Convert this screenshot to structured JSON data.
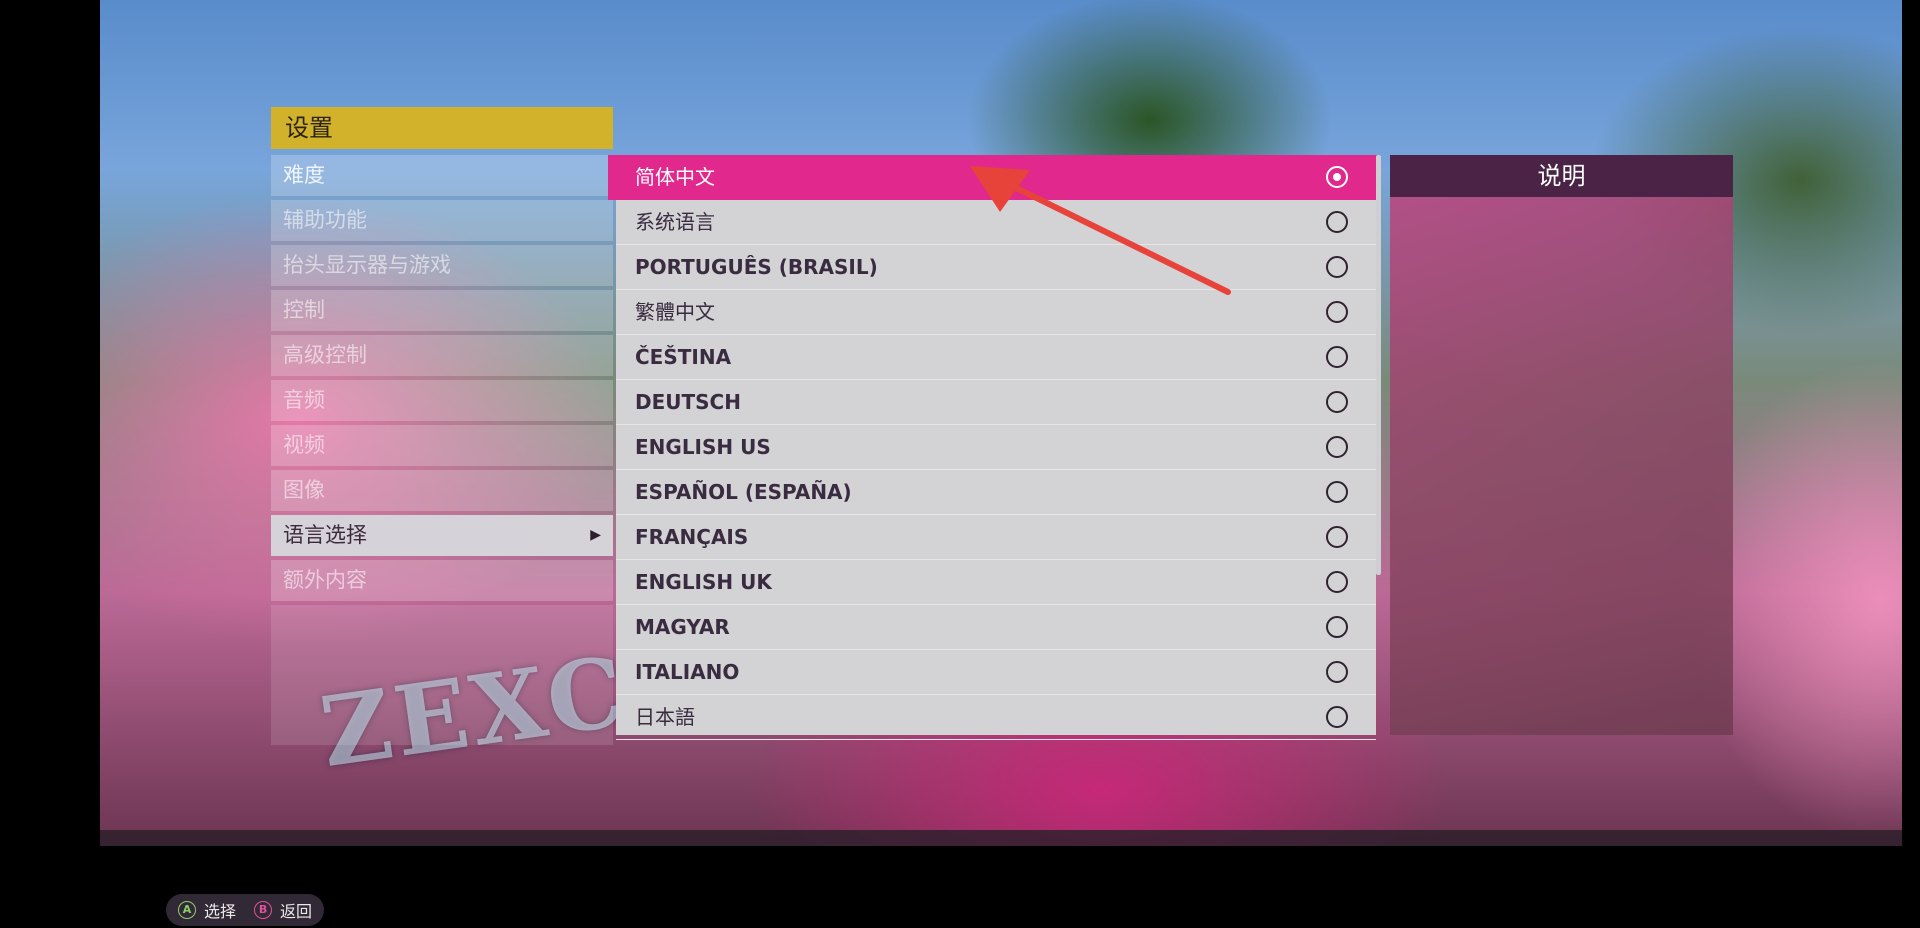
{
  "settings": {
    "title": "设置",
    "menu": [
      {
        "label": "难度"
      },
      {
        "label": "辅助功能"
      },
      {
        "label": "抬头显示器与游戏"
      },
      {
        "label": "控制"
      },
      {
        "label": "高级控制"
      },
      {
        "label": "音频"
      },
      {
        "label": "视频"
      },
      {
        "label": "图像"
      },
      {
        "label": "语言选择",
        "active": true
      },
      {
        "label": "额外内容"
      }
    ]
  },
  "languages": [
    {
      "label": "简体中文",
      "selected": true
    },
    {
      "label": "系统语言"
    },
    {
      "label": "PORTUGUÊS (BRASIL)"
    },
    {
      "label": "繁體中文"
    },
    {
      "label": "ČEŠTINA"
    },
    {
      "label": "DEUTSCH"
    },
    {
      "label": "ENGLISH US"
    },
    {
      "label": "ESPAÑOL (ESPAÑA)"
    },
    {
      "label": "FRANÇAIS"
    },
    {
      "label": "ENGLISH UK"
    },
    {
      "label": "MAGYAR"
    },
    {
      "label": "ITALIANO"
    },
    {
      "label": "日本語"
    }
  ],
  "description": {
    "title": "说明"
  },
  "background": {
    "graffiti_text": "ZEXCS"
  },
  "hints": {
    "select_key": "A",
    "select_label": "选择",
    "back_key": "B",
    "back_label": "返回"
  },
  "colors": {
    "accent_pink": "#e1288c",
    "title_gold": "#d2b22a",
    "annotation_red": "#e8433a"
  }
}
